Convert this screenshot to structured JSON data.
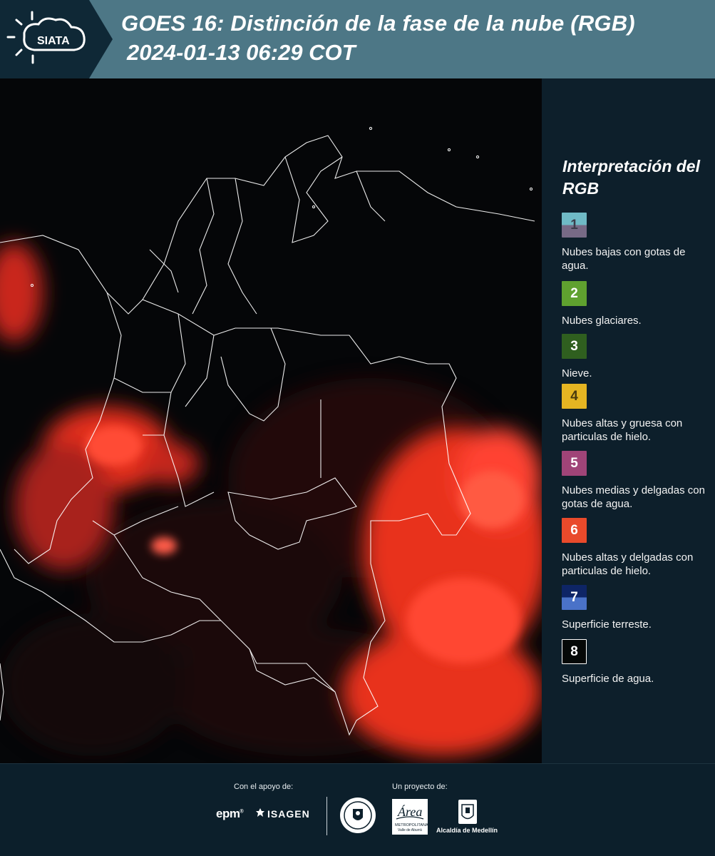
{
  "header": {
    "brand": "SIATA",
    "title": "GOES 16: Distinción de la fase de la nube (RGB)",
    "subtitle": "2024-01-13 06:29 COT",
    "background_color": "#4d7786"
  },
  "map": {
    "layer": "cloud-phase-rgb",
    "background_color": "#050608",
    "cloud_color": "#ff3b28",
    "border_color": "#ffffff"
  },
  "legend": {
    "title": "Interpretación del RGB",
    "items": [
      {
        "number": "1",
        "text": "Nubes bajas con gotas de agua.",
        "color_top": "#6fbac6",
        "color_bottom": "#776a86"
      },
      {
        "number": "2",
        "text": "Nubes glaciares.",
        "color_top": "#5fa12f",
        "color_bottom": "#5fa12f"
      },
      {
        "number": "3",
        "text": "Nieve.",
        "color_top": "#2f5f1f",
        "color_bottom": "#2f5f1f"
      },
      {
        "number": "4",
        "text": "Nubes altas y gruesa con particulas de hielo.",
        "color_top": "#e5b522",
        "color_bottom": "#e5b522"
      },
      {
        "number": "5",
        "text": "Nubes medias y delgadas con gotas de agua.",
        "color_top": "#a04478",
        "color_bottom": "#a04478"
      },
      {
        "number": "6",
        "text": "Nubes altas y delgadas con particulas de hielo.",
        "color_top": "#e94a2b",
        "color_bottom": "#e94a2b"
      },
      {
        "number": "7",
        "text": "Superficie terreste.",
        "color_top": "#0e2566",
        "color_bottom": "#4a72c8"
      },
      {
        "number": "8",
        "text": "Superficie de agua.",
        "color_top": "#050807",
        "color_bottom": "#050807"
      }
    ]
  },
  "footer": {
    "support_label": "Con el apoyo de:",
    "project_label": "Un proyecto de:",
    "sponsors": [
      "epm",
      "ISAGEN"
    ],
    "partners": [
      "Área Metropolitana Valle de Aburrá",
      "Alcaldía de Medellín"
    ],
    "epm_text": "epm",
    "isagen_text": "ISAGEN",
    "alcaldia_text": "Alcaldía de Medellín"
  }
}
